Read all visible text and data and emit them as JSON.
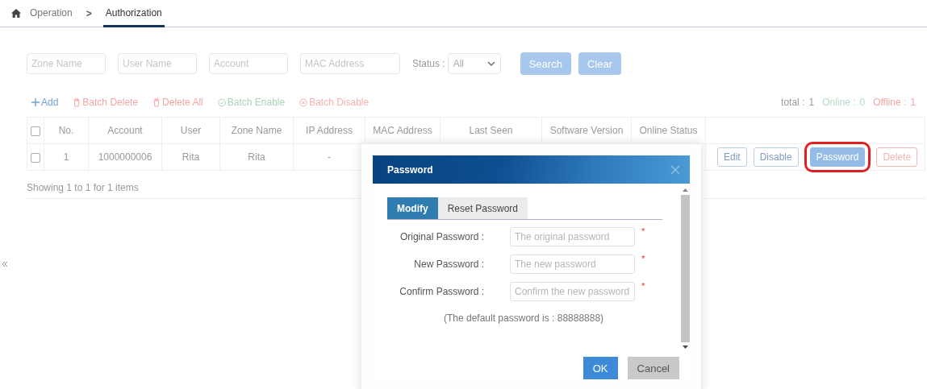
{
  "breadcrumb": {
    "separator": ">",
    "items": [
      {
        "label": "Operation",
        "selected": false
      },
      {
        "label": "Authorization",
        "selected": true
      }
    ]
  },
  "filters": {
    "fields": [
      {
        "placeholder": "Zone Name"
      },
      {
        "placeholder": "User Name"
      },
      {
        "placeholder": "Account"
      },
      {
        "placeholder": "MAC Address"
      }
    ],
    "status": {
      "label": "Status :",
      "value": "All"
    },
    "buttons": [
      "Search",
      "Clear"
    ]
  },
  "toolbar": {
    "actions": [
      {
        "kind": "add",
        "label": "Add"
      },
      {
        "kind": "delete",
        "label": "Batch Delete"
      },
      {
        "kind": "delete",
        "label": "Delete All"
      },
      {
        "kind": "enable",
        "label": "Batch Enable"
      },
      {
        "kind": "disable",
        "label": "Batch Disable"
      }
    ],
    "summary": [
      {
        "kind": "total",
        "label": "total :",
        "value": "1"
      },
      {
        "kind": "online",
        "label": "Online :",
        "value": "0"
      },
      {
        "kind": "offline",
        "label": "Offline :",
        "value": "1"
      }
    ]
  },
  "table": {
    "header_checked": false,
    "columns": [
      "No.",
      "Account",
      "User",
      "Zone Name",
      "IP Address",
      "MAC Address",
      "Last Seen",
      "Software Version",
      "Online Status"
    ],
    "rows": [
      {
        "checked": false,
        "cells": [
          "1",
          "1000000006",
          "Rita",
          "Rita",
          "-",
          "",
          "",
          "",
          ""
        ],
        "actions": [
          {
            "kind": "edit",
            "label": "Edit",
            "highlighted": false
          },
          {
            "kind": "edit",
            "label": "Disable",
            "highlighted": false
          },
          {
            "kind": "primary",
            "label": "Password",
            "highlighted": true
          },
          {
            "kind": "danger",
            "label": "Delete",
            "highlighted": false
          }
        ]
      }
    ]
  },
  "footer": "Showing 1 to 1 for 1 items",
  "dialog": {
    "title": "Password",
    "tabs": [
      {
        "label": "Modify",
        "selected": true
      },
      {
        "label": "Reset Password",
        "selected": false
      }
    ],
    "fields": [
      {
        "label": "Original Password :",
        "placeholder": "The original password",
        "mark": "*"
      },
      {
        "label": "New Password :",
        "placeholder": "The new password",
        "mark": "*"
      },
      {
        "label": "Confirm Password :",
        "placeholder": "Confirm the new password",
        "mark": "*"
      }
    ],
    "note": "(The default password is : 88888888)",
    "buttons": [
      {
        "kind": "primary",
        "label": "OK"
      },
      {
        "kind": "secondary",
        "label": "Cancel"
      }
    ]
  }
}
